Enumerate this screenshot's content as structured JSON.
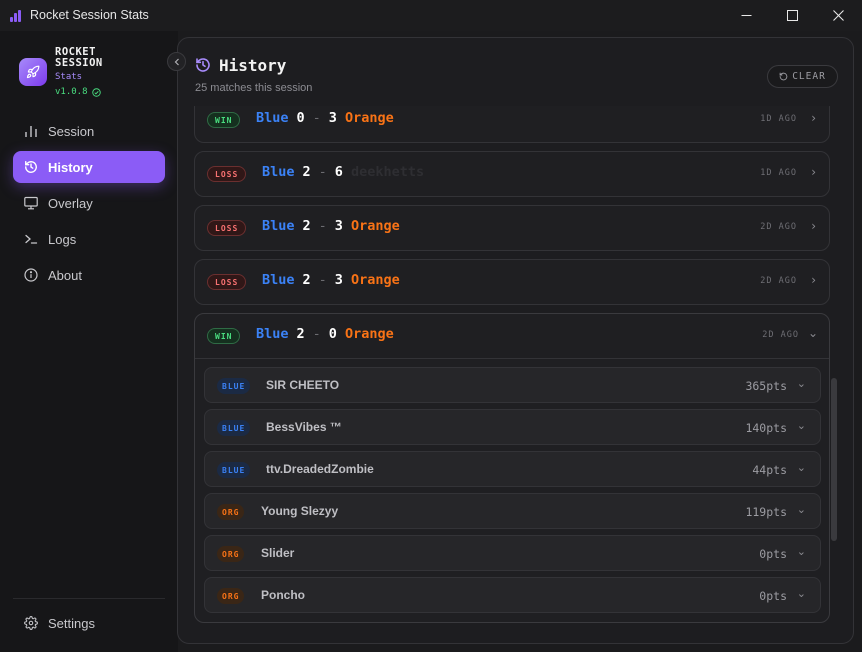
{
  "window": {
    "title": "Rocket Session Stats",
    "controls": {
      "minimize": "—",
      "maximize": "☐",
      "close": "✕"
    }
  },
  "sidebar": {
    "brand_line1": "ROCKET",
    "brand_line2": "SESSION",
    "brand_sub": "Stats",
    "version": "v1.0.8",
    "items": [
      {
        "label": "Session",
        "icon": "bar-chart-icon",
        "active": false
      },
      {
        "label": "History",
        "icon": "history-icon",
        "active": true
      },
      {
        "label": "Overlay",
        "icon": "monitor-icon",
        "active": false
      },
      {
        "label": "Logs",
        "icon": "terminal-icon",
        "active": false
      },
      {
        "label": "About",
        "icon": "info-icon",
        "active": false
      }
    ],
    "settings_label": "Settings"
  },
  "history": {
    "title": "History",
    "subtitle": "25 matches this session",
    "clear_label": "CLEAR",
    "matches": [
      {
        "result": "WIN",
        "team_a": "Blue",
        "score_a": "0",
        "sep": "-",
        "score_b": "3",
        "team_b": "Orange",
        "ago": "1D AGO"
      },
      {
        "result": "LOSS",
        "team_a": "Blue",
        "score_a": "2",
        "sep": "-",
        "score_b": "6",
        "team_b": "deekhetts",
        "ago": "1D AGO"
      },
      {
        "result": "LOSS",
        "team_a": "Blue",
        "score_a": "2",
        "sep": "-",
        "score_b": "3",
        "team_b": "Orange",
        "ago": "2D AGO"
      },
      {
        "result": "LOSS",
        "team_a": "Blue",
        "score_a": "2",
        "sep": "-",
        "score_b": "3",
        "team_b": "Orange",
        "ago": "2D AGO"
      }
    ],
    "expanded": {
      "result": "WIN",
      "team_a": "Blue",
      "score_a": "2",
      "sep": "-",
      "score_b": "0",
      "team_b": "Orange",
      "ago": "2D AGO",
      "players": [
        {
          "team": "BLUE",
          "name": "SIR CHEETO",
          "points": "365pts"
        },
        {
          "team": "BLUE",
          "name": "BessVibes ™",
          "points": "140pts"
        },
        {
          "team": "BLUE",
          "name": "ttv.DreadedZombie",
          "points": "44pts"
        },
        {
          "team": "ORG",
          "name": "Young Slezyy",
          "points": "119pts"
        },
        {
          "team": "ORG",
          "name": "Slider",
          "points": "0pts"
        },
        {
          "team": "ORG",
          "name": "Poncho",
          "points": "0pts"
        }
      ]
    }
  },
  "colors": {
    "accent": "#8b5cf6",
    "blue_team": "#3b82f6",
    "orange_team": "#f97316",
    "win": "#4ade80",
    "loss": "#f87171"
  }
}
